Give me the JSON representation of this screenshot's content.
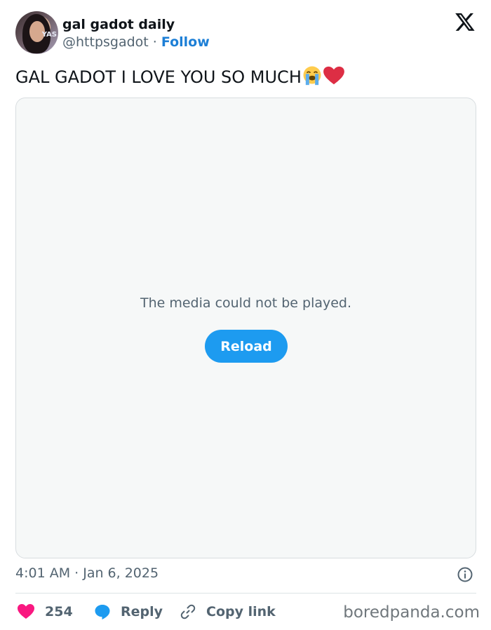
{
  "author": {
    "display_name": "gal gadot daily",
    "handle": "@httpsgadot",
    "separator": "·",
    "follow_label": "Follow",
    "avatar_tag": "YAS"
  },
  "platform": {
    "logo_icon": "x-logo-icon"
  },
  "tweet": {
    "text": "GAL GADOT I LOVE YOU SO MUCH",
    "emojis": [
      "loudly-crying-face-emoji",
      "red-heart-emoji"
    ]
  },
  "media": {
    "message": "The media could not be played.",
    "reload_label": "Reload"
  },
  "meta": {
    "timestamp": "4:01 AM · Jan 6, 2025",
    "info_icon": "info-icon"
  },
  "actions": {
    "like_count": "254",
    "reply_label": "Reply",
    "copy_link_label": "Copy link"
  },
  "watermark": "boredpanda.com",
  "colors": {
    "accent": "#1d9bf0",
    "follow": "#1d7fd6",
    "like": "#f91880",
    "secondary_text": "#536471",
    "media_bg": "#f6f8f8"
  }
}
